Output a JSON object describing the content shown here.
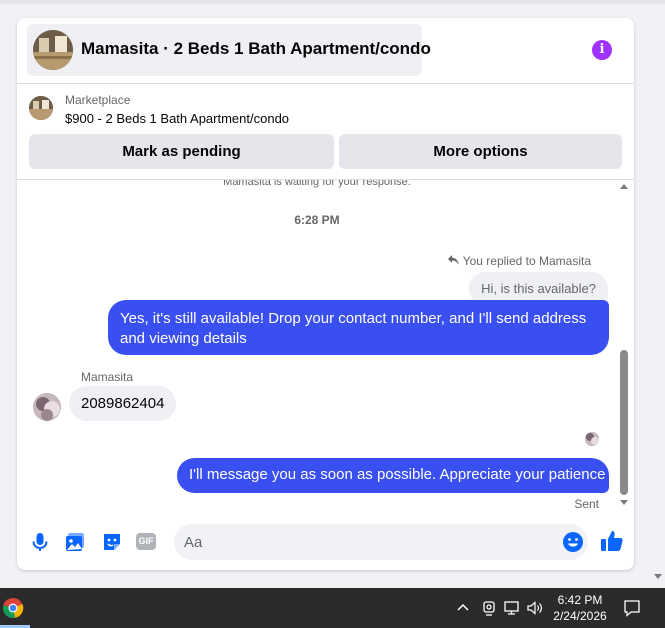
{
  "header": {
    "title": "Mamasita · 2 Beds 1 Bath Apartment/condo",
    "info_icon": "info-icon",
    "accent_color": "#a033ff"
  },
  "marketplace": {
    "label": "Marketplace",
    "listing": "$900 - 2 Beds 1 Bath Apartment/condo",
    "mark_pending_label": "Mark as pending",
    "more_options_label": "More options"
  },
  "thread": {
    "waiting_note": "Mamasita is waiting for your response.",
    "timestamp": "6:28 PM",
    "reply_note": "You replied to Mamasita",
    "quoted_message": "Hi, is this available?",
    "messages": [
      {
        "direction": "outgoing",
        "text": "Yes, it's still available! Drop your contact number, and I'll send address and viewing details"
      },
      {
        "direction": "incoming",
        "sender": "Mamasita",
        "text": "2089862404"
      },
      {
        "direction": "outgoing",
        "text": "I'll message you as soon as possible. Appreciate your patience"
      }
    ],
    "sent_status": "Sent",
    "outgoing_color": "#3a4ff0",
    "incoming_color": "#eef0f3"
  },
  "composer": {
    "placeholder": "Aa",
    "icons": [
      "microphone-icon",
      "image-icon",
      "sticker-icon",
      "gif-icon",
      "emoji-icon",
      "like-icon"
    ],
    "gif_label": "GIF",
    "accent_color": "#0a66ff"
  },
  "taskbar": {
    "time": "6:42 PM",
    "date": "2/24/2026",
    "tray_icons": [
      "chevron-up-icon",
      "meet-now-icon",
      "network-icon",
      "volume-icon",
      "notification-icon"
    ]
  }
}
